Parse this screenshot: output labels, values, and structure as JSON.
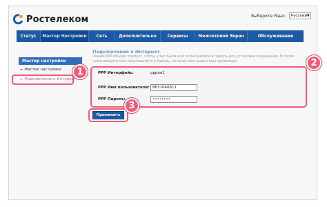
{
  "header": {
    "logo_text": "Ростелеком",
    "language_label": "Выберите Язык:",
    "language_value": "Русский"
  },
  "nav": {
    "items": [
      {
        "label": "Статус"
      },
      {
        "label": "Мастер Настройки"
      },
      {
        "label": "Сеть"
      },
      {
        "label": "Дополнительно"
      },
      {
        "label": "Сервисы"
      },
      {
        "label": "Межсетевой Экран"
      },
      {
        "label": "Обслуживание"
      }
    ],
    "active_index": 1
  },
  "sidebar": {
    "title": "Мастер настройки",
    "items": [
      {
        "label": "Мастер настройки"
      },
      {
        "label": "Подключение к Интернет"
      }
    ],
    "current_index": 1
  },
  "content": {
    "title": "Подключение к Интернет",
    "description": "Режим PPP обычно требует, чтобы у вас были имя пользователя и пароль для установки соединения. В полях ниже введите имя пользователя и пароль, которые вам выдал ваш провайдер."
  },
  "form": {
    "interface_label": "PPP Интерфейс:",
    "interface_value": "pppoe1",
    "username_label": "PPP Имя пользователя:",
    "username_value": "8631040611",
    "password_label": "PPP Пароль:",
    "password_value": "••••••••"
  },
  "apply_button": "Применить",
  "badges": [
    "1",
    "2",
    "3"
  ],
  "colors": {
    "nav_bg": "#1c5aa6",
    "highlight": "#ef5c78",
    "title_blue": "#5aa0d0"
  }
}
